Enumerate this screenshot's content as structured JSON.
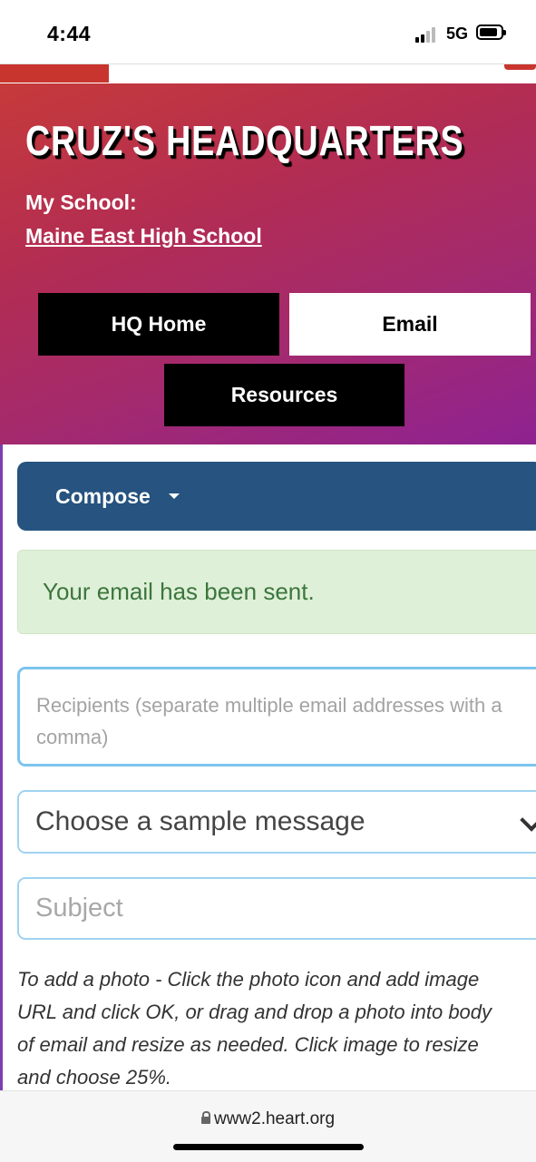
{
  "status_bar": {
    "time": "4:44",
    "network": "5G"
  },
  "header": {
    "title": "CRUZ'S HEADQUARTERS",
    "school_label": "My School:",
    "school_name": "Maine East High School"
  },
  "nav": {
    "hq_home": "HQ Home",
    "email": "Email",
    "resources": "Resources"
  },
  "compose": {
    "label": "Compose"
  },
  "alert": {
    "message": "Your email has been sent."
  },
  "form": {
    "recipients_placeholder": "Recipients (separate multiple email addresses with a comma)",
    "sample_message_selected": "Choose a sample message",
    "subject_placeholder": "Subject",
    "help_text": "To add a photo - Click the photo icon and add image\nURL and click OK, or drag and drop a photo into body\nof email and resize as needed. Click image to resize\nand choose 25%."
  },
  "browser": {
    "url": "www2.heart.org"
  },
  "colors": {
    "gradient_start": "#c63a3a",
    "gradient_end": "#8e2291",
    "compose_bg": "#26537f",
    "alert_bg": "#dff0d8",
    "alert_text": "#3c763d",
    "field_border": "#9fd3f0"
  }
}
